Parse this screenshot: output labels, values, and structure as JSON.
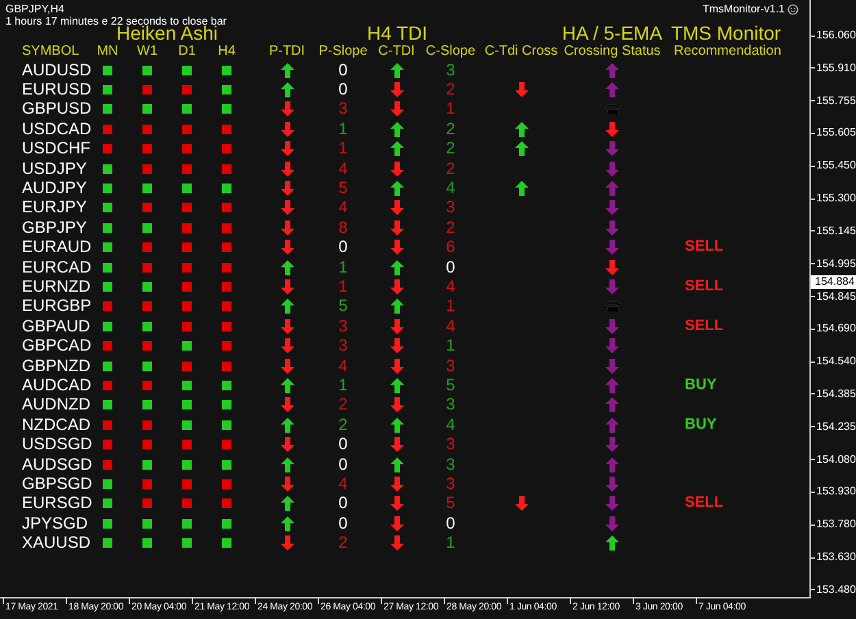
{
  "chart": {
    "symbol_timeframe": "GBPJPY,H4",
    "countdown": "1 hours 17 minutes e 22 seconds to close bar",
    "expert_name": "TmsMonitor-v1.1"
  },
  "groups": [
    {
      "label": "Heiken Ashi"
    },
    {
      "label": "H4 TDI"
    },
    {
      "label": "HA / 5-EMA"
    },
    {
      "label": "TMS Monitor"
    }
  ],
  "columns": [
    "SYMBOL",
    "MN",
    "W1",
    "D1",
    "H4",
    "P-TDI",
    "P-Slope",
    "C-TDI",
    "C-Slope",
    "C-Tdi Cross",
    "Crossing Status",
    "Recommendation"
  ],
  "rows": [
    {
      "symbol": "AUDUSD",
      "ha": [
        {
          "bullish": true
        },
        {
          "bullish": true
        },
        {
          "bullish": true
        },
        {
          "bullish": true
        }
      ],
      "p_tdi": {
        "rising": true
      },
      "p_slope": {
        "text": "0",
        "color": "#ffffff"
      },
      "c_tdi": {
        "rising": true
      },
      "c_slope": {
        "text": "3",
        "color": "#22a022"
      },
      "status": {
        "kind": "arrow",
        "rising": true,
        "color": "#8b1a8b"
      }
    },
    {
      "symbol": "EURUSD",
      "ha": [
        {
          "bullish": true
        },
        {
          "bullish": false
        },
        {
          "bullish": false
        },
        {
          "bullish": true
        }
      ],
      "p_tdi": {
        "rising": true
      },
      "p_slope": {
        "text": "0",
        "color": "#ffffff"
      },
      "c_tdi": {
        "rising": false
      },
      "c_slope": {
        "text": "2",
        "color": "#d01010"
      },
      "cross": {
        "rising": false
      },
      "status": {
        "kind": "arrow",
        "rising": true,
        "color": "#8b1a8b"
      }
    },
    {
      "symbol": "GBPUSD",
      "ha": [
        {
          "bullish": true
        },
        {
          "bullish": true
        },
        {
          "bullish": true
        },
        {
          "bullish": true
        }
      ],
      "p_tdi": {
        "rising": false
      },
      "p_slope": {
        "text": "3",
        "color": "#d01010"
      },
      "c_tdi": {
        "rising": false
      },
      "c_slope": {
        "text": "1",
        "color": "#d01010"
      },
      "status": {
        "kind": "phone"
      }
    },
    {
      "symbol": "USDCAD",
      "ha": [
        {
          "bullish": false
        },
        {
          "bullish": false
        },
        {
          "bullish": false
        },
        {
          "bullish": false
        }
      ],
      "p_tdi": {
        "rising": false
      },
      "p_slope": {
        "text": "1",
        "color": "#22a022"
      },
      "c_tdi": {
        "rising": true
      },
      "c_slope": {
        "text": "2",
        "color": "#22a022"
      },
      "cross": {
        "rising": true
      },
      "status": {
        "kind": "arrow",
        "rising": false,
        "color": "#ff1a1a"
      }
    },
    {
      "symbol": "USDCHF",
      "ha": [
        {
          "bullish": false
        },
        {
          "bullish": false
        },
        {
          "bullish": false
        },
        {
          "bullish": false
        }
      ],
      "p_tdi": {
        "rising": false
      },
      "p_slope": {
        "text": "1",
        "color": "#d01010"
      },
      "c_tdi": {
        "rising": true
      },
      "c_slope": {
        "text": "2",
        "color": "#22a022"
      },
      "cross": {
        "rising": true
      },
      "status": {
        "kind": "arrow",
        "rising": false,
        "color": "#8b1a8b"
      }
    },
    {
      "symbol": "USDJPY",
      "ha": [
        {
          "bullish": true
        },
        {
          "bullish": false
        },
        {
          "bullish": false
        },
        {
          "bullish": false
        }
      ],
      "p_tdi": {
        "rising": false
      },
      "p_slope": {
        "text": "4",
        "color": "#d01010"
      },
      "c_tdi": {
        "rising": false
      },
      "c_slope": {
        "text": "2",
        "color": "#d01010"
      },
      "status": {
        "kind": "arrow",
        "rising": false,
        "color": "#8b1a8b"
      }
    },
    {
      "symbol": "AUDJPY",
      "ha": [
        {
          "bullish": true
        },
        {
          "bullish": true
        },
        {
          "bullish": true
        },
        {
          "bullish": true
        }
      ],
      "p_tdi": {
        "rising": false
      },
      "p_slope": {
        "text": "5",
        "color": "#d01010"
      },
      "c_tdi": {
        "rising": true
      },
      "c_slope": {
        "text": "4",
        "color": "#22a022"
      },
      "cross": {
        "rising": true
      },
      "status": {
        "kind": "arrow",
        "rising": true,
        "color": "#8b1a8b"
      }
    },
    {
      "symbol": "EURJPY",
      "ha": [
        {
          "bullish": true
        },
        {
          "bullish": false
        },
        {
          "bullish": false
        },
        {
          "bullish": false
        }
      ],
      "p_tdi": {
        "rising": false
      },
      "p_slope": {
        "text": "4",
        "color": "#d01010"
      },
      "c_tdi": {
        "rising": false
      },
      "c_slope": {
        "text": "3",
        "color": "#d01010"
      },
      "status": {
        "kind": "arrow",
        "rising": false,
        "color": "#8b1a8b"
      }
    },
    {
      "symbol": "GBPJPY",
      "ha": [
        {
          "bullish": true
        },
        {
          "bullish": true
        },
        {
          "bullish": false
        },
        {
          "bullish": false
        }
      ],
      "p_tdi": {
        "rising": false
      },
      "p_slope": {
        "text": "8",
        "color": "#d01010"
      },
      "c_tdi": {
        "rising": false
      },
      "c_slope": {
        "text": "2",
        "color": "#d01010"
      },
      "status": {
        "kind": "arrow",
        "rising": false,
        "color": "#8b1a8b"
      }
    },
    {
      "symbol": "EURAUD",
      "ha": [
        {
          "bullish": true
        },
        {
          "bullish": false
        },
        {
          "bullish": false
        },
        {
          "bullish": false
        }
      ],
      "p_tdi": {
        "rising": false
      },
      "p_slope": {
        "text": "0",
        "color": "#ffffff"
      },
      "c_tdi": {
        "rising": false
      },
      "c_slope": {
        "text": "6",
        "color": "#d01010"
      },
      "status": {
        "kind": "arrow",
        "rising": false,
        "color": "#8b1a8b"
      },
      "recommendation": {
        "text": "SELL",
        "color": "#ff1a1a"
      }
    },
    {
      "symbol": "EURCAD",
      "ha": [
        {
          "bullish": true
        },
        {
          "bullish": false
        },
        {
          "bullish": false
        },
        {
          "bullish": false
        }
      ],
      "p_tdi": {
        "rising": true
      },
      "p_slope": {
        "text": "1",
        "color": "#22a022"
      },
      "c_tdi": {
        "rising": true
      },
      "c_slope": {
        "text": "0",
        "color": "#ffffff"
      },
      "status": {
        "kind": "arrow",
        "rising": false,
        "color": "#ff1a1a"
      }
    },
    {
      "symbol": "EURNZD",
      "ha": [
        {
          "bullish": true
        },
        {
          "bullish": true
        },
        {
          "bullish": false
        },
        {
          "bullish": false
        }
      ],
      "p_tdi": {
        "rising": false
      },
      "p_slope": {
        "text": "1",
        "color": "#d01010"
      },
      "c_tdi": {
        "rising": false
      },
      "c_slope": {
        "text": "4",
        "color": "#d01010"
      },
      "status": {
        "kind": "arrow",
        "rising": false,
        "color": "#8b1a8b"
      },
      "recommendation": {
        "text": "SELL",
        "color": "#ff1a1a"
      }
    },
    {
      "symbol": "EURGBP",
      "ha": [
        {
          "bullish": false
        },
        {
          "bullish": false
        },
        {
          "bullish": false
        },
        {
          "bullish": false
        }
      ],
      "p_tdi": {
        "rising": true
      },
      "p_slope": {
        "text": "5",
        "color": "#22a022"
      },
      "c_tdi": {
        "rising": true
      },
      "c_slope": {
        "text": "1",
        "color": "#d01010"
      },
      "status": {
        "kind": "phone"
      }
    },
    {
      "symbol": "GBPAUD",
      "ha": [
        {
          "bullish": true
        },
        {
          "bullish": true
        },
        {
          "bullish": false
        },
        {
          "bullish": false
        }
      ],
      "p_tdi": {
        "rising": false
      },
      "p_slope": {
        "text": "3",
        "color": "#d01010"
      },
      "c_tdi": {
        "rising": false
      },
      "c_slope": {
        "text": "4",
        "color": "#d01010"
      },
      "status": {
        "kind": "arrow",
        "rising": false,
        "color": "#8b1a8b"
      },
      "recommendation": {
        "text": "SELL",
        "color": "#ff1a1a"
      }
    },
    {
      "symbol": "GBPCAD",
      "ha": [
        {
          "bullish": false
        },
        {
          "bullish": false
        },
        {
          "bullish": true
        },
        {
          "bullish": false
        }
      ],
      "p_tdi": {
        "rising": false
      },
      "p_slope": {
        "text": "3",
        "color": "#d01010"
      },
      "c_tdi": {
        "rising": false
      },
      "c_slope": {
        "text": "1",
        "color": "#22a022"
      },
      "status": {
        "kind": "arrow",
        "rising": false,
        "color": "#8b1a8b"
      }
    },
    {
      "symbol": "GBPNZD",
      "ha": [
        {
          "bullish": true
        },
        {
          "bullish": true
        },
        {
          "bullish": false
        },
        {
          "bullish": false
        }
      ],
      "p_tdi": {
        "rising": false
      },
      "p_slope": {
        "text": "4",
        "color": "#d01010"
      },
      "c_tdi": {
        "rising": false
      },
      "c_slope": {
        "text": "3",
        "color": "#d01010"
      },
      "status": {
        "kind": "arrow",
        "rising": false,
        "color": "#8b1a8b"
      }
    },
    {
      "symbol": "AUDCAD",
      "ha": [
        {
          "bullish": false
        },
        {
          "bullish": false
        },
        {
          "bullish": true
        },
        {
          "bullish": true
        }
      ],
      "p_tdi": {
        "rising": true
      },
      "p_slope": {
        "text": "1",
        "color": "#22a022"
      },
      "c_tdi": {
        "rising": true
      },
      "c_slope": {
        "text": "5",
        "color": "#22a022"
      },
      "status": {
        "kind": "arrow",
        "rising": true,
        "color": "#8b1a8b"
      },
      "recommendation": {
        "text": "BUY",
        "color": "#33cc22"
      }
    },
    {
      "symbol": "AUDNZD",
      "ha": [
        {
          "bullish": true
        },
        {
          "bullish": true
        },
        {
          "bullish": true
        },
        {
          "bullish": true
        }
      ],
      "p_tdi": {
        "rising": false
      },
      "p_slope": {
        "text": "2",
        "color": "#d01010"
      },
      "c_tdi": {
        "rising": false
      },
      "c_slope": {
        "text": "3",
        "color": "#22a022"
      },
      "status": {
        "kind": "arrow",
        "rising": true,
        "color": "#8b1a8b"
      }
    },
    {
      "symbol": "NZDCAD",
      "ha": [
        {
          "bullish": false
        },
        {
          "bullish": false
        },
        {
          "bullish": true
        },
        {
          "bullish": true
        }
      ],
      "p_tdi": {
        "rising": true
      },
      "p_slope": {
        "text": "2",
        "color": "#22a022"
      },
      "c_tdi": {
        "rising": true
      },
      "c_slope": {
        "text": "4",
        "color": "#22a022"
      },
      "status": {
        "kind": "arrow",
        "rising": true,
        "color": "#8b1a8b"
      },
      "recommendation": {
        "text": "BUY",
        "color": "#33cc22"
      }
    },
    {
      "symbol": "USDSGD",
      "ha": [
        {
          "bullish": false
        },
        {
          "bullish": false
        },
        {
          "bullish": false
        },
        {
          "bullish": false
        }
      ],
      "p_tdi": {
        "rising": false
      },
      "p_slope": {
        "text": "0",
        "color": "#ffffff"
      },
      "c_tdi": {
        "rising": false
      },
      "c_slope": {
        "text": "3",
        "color": "#d01010"
      },
      "status": {
        "kind": "arrow",
        "rising": false,
        "color": "#8b1a8b"
      }
    },
    {
      "symbol": "AUDSGD",
      "ha": [
        {
          "bullish": false
        },
        {
          "bullish": true
        },
        {
          "bullish": true
        },
        {
          "bullish": true
        }
      ],
      "p_tdi": {
        "rising": true
      },
      "p_slope": {
        "text": "0",
        "color": "#ffffff"
      },
      "c_tdi": {
        "rising": true
      },
      "c_slope": {
        "text": "3",
        "color": "#22a022"
      },
      "status": {
        "kind": "arrow",
        "rising": true,
        "color": "#8b1a8b"
      }
    },
    {
      "symbol": "GBPSGD",
      "ha": [
        {
          "bullish": true
        },
        {
          "bullish": false
        },
        {
          "bullish": false
        },
        {
          "bullish": false
        }
      ],
      "p_tdi": {
        "rising": false
      },
      "p_slope": {
        "text": "4",
        "color": "#d01010"
      },
      "c_tdi": {
        "rising": false
      },
      "c_slope": {
        "text": "3",
        "color": "#d01010"
      },
      "status": {
        "kind": "arrow",
        "rising": false,
        "color": "#8b1a8b"
      }
    },
    {
      "symbol": "EURSGD",
      "ha": [
        {
          "bullish": true
        },
        {
          "bullish": false
        },
        {
          "bullish": false
        },
        {
          "bullish": false
        }
      ],
      "p_tdi": {
        "rising": true
      },
      "p_slope": {
        "text": "0",
        "color": "#ffffff"
      },
      "c_tdi": {
        "rising": false
      },
      "c_slope": {
        "text": "5",
        "color": "#d01010"
      },
      "cross": {
        "rising": false
      },
      "status": {
        "kind": "arrow",
        "rising": false,
        "color": "#8b1a8b"
      },
      "recommendation": {
        "text": "SELL",
        "color": "#ff1a1a"
      }
    },
    {
      "symbol": "JPYSGD",
      "ha": [
        {
          "bullish": true
        },
        {
          "bullish": true
        },
        {
          "bullish": true
        },
        {
          "bullish": true
        }
      ],
      "p_tdi": {
        "rising": true
      },
      "p_slope": {
        "text": "0",
        "color": "#ffffff"
      },
      "c_tdi": {
        "rising": false
      },
      "c_slope": {
        "text": "0",
        "color": "#ffffff"
      },
      "status": {
        "kind": "arrow",
        "rising": false,
        "color": "#8b1a8b"
      }
    },
    {
      "symbol": "XAUUSD",
      "ha": [
        {
          "bullish": true
        },
        {
          "bullish": true
        },
        {
          "bullish": true
        },
        {
          "bullish": true
        }
      ],
      "p_tdi": {
        "rising": false
      },
      "p_slope": {
        "text": "2",
        "color": "#d01010"
      },
      "c_tdi": {
        "rising": false
      },
      "c_slope": {
        "text": "1",
        "color": "#22a022"
      },
      "status": {
        "kind": "arrow",
        "rising": true,
        "color": "#22cc22"
      }
    }
  ],
  "price_axis": [
    "156.060",
    "155.910",
    "155.755",
    "155.605",
    "155.450",
    "155.300",
    "155.145",
    "154.995",
    "154.845",
    "154.690",
    "154.540",
    "154.385",
    "154.235",
    "154.080",
    "153.930",
    "153.780",
    "153.630",
    "153.480"
  ],
  "current_price": "154.884",
  "time_axis": [
    "17 May 2021",
    "18 May 20:00",
    "20 May 04:00",
    "21 May 12:00",
    "24 May 20:00",
    "26 May 04:00",
    "27 May 12:00",
    "28 May 20:00",
    "1 Jun 04:00",
    "2 Jun 12:00",
    "3 Jun 20:00",
    "7 Jun 04:00"
  ]
}
